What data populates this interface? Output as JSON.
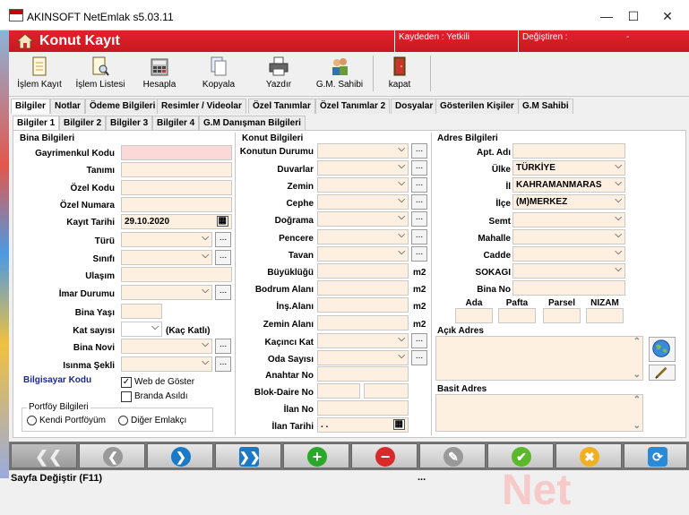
{
  "window": {
    "title": "AKINSOFT NetEmlak s5.03.11",
    "minimize": "—",
    "maximize": "☐",
    "close": "✕"
  },
  "header": {
    "form_title": "Konut Kayıt",
    "kaydeden": "Kaydeden : Yetkili",
    "degistiren": "Değiştiren :",
    "degistiren_value": "-",
    "color": "#d81e26"
  },
  "toolbar": [
    {
      "label": "İşlem Kayıt",
      "icon": "document-icon"
    },
    {
      "label": "İşlem Listesi",
      "icon": "search-document-icon"
    },
    {
      "label": "Hesapla",
      "icon": "calculator-icon"
    },
    {
      "label": "Kopyala",
      "icon": "copy-icon"
    },
    {
      "label": "Yazdır",
      "icon": "printer-icon"
    },
    {
      "label": "G.M. Sahibi",
      "icon": "users-icon"
    },
    {
      "label": "kapat",
      "icon": "exit-icon"
    }
  ],
  "tabs_main": [
    "Bilgiler",
    "Notlar",
    "Ödeme Bilgileri",
    "Resimler / Videolar",
    "Özel Tanımlar",
    "Özel Tanımlar 2",
    "Dosyalar",
    "Gösterilen Kişiler",
    "G.M Sahibi"
  ],
  "tabs_sub": [
    "Bilgiler 1",
    "Bilgiler 2",
    "Bilgiler 3",
    "Bilgiler 4",
    "G.M Danışman Bilgileri"
  ],
  "bina": {
    "section": "Bina Bilgileri",
    "gayrimenkul_kodu": "Gayrimenkul Kodu",
    "tanimi": "Tanımı",
    "ozel_kodu": "Özel Kodu",
    "ozel_numara": "Özel Numara",
    "kayit_tarihi": "Kayıt Tarihi",
    "kayit_tarihi_value": "29.10.2020",
    "turu": "Türü",
    "sinifi": "Sınıfı",
    "ulasim": "Ulaşım",
    "imar_durumu": "İmar Durumu",
    "bina_yasi": "Bina Yaşı",
    "kat_sayisi": "Kat sayısı",
    "kac_katli": "(Kaç Katlı)",
    "bina_novi": "Bina Novi",
    "isinma_sekli": "Isınma Şekli",
    "bilgisayar_kodu": "Bilgisayar Kodu",
    "web_de_goster": "Web de Göster",
    "branda_asildi": "Branda Asıldı",
    "portfoy": "Portföy Bilgileri",
    "kendi_portfoyum": "Kendi Portföyüm",
    "diger_emlakci": "Diğer Emlakçı",
    "dots": "..."
  },
  "konut": {
    "section": "Konut Bilgileri",
    "konutun_durumu": "Konutun Durumu",
    "duvarlar": "Duvarlar",
    "zemin": "Zemin",
    "cephe": "Cephe",
    "dograma": "Doğrama",
    "pencere": "Pencere",
    "tavan": "Tavan",
    "buyuklugu": "Büyüklüğü",
    "bodrum_alani": "Bodrum Alanı",
    "ins_alani": "İnş.Alanı",
    "zemin_alani": "Zemin Alanı",
    "kacinci_kat": "Kaçıncı Kat",
    "oda_sayisi": "Oda Sayısı",
    "anahtar_no": "Anahtar No",
    "blok_daire_no": "Blok-Daire No",
    "ilan_no": "İlan No",
    "ilan_tarihi": "İlan Tarihi",
    "ilan_tarihi_value": " .  .",
    "m2": "m2"
  },
  "adres": {
    "section": "Adres Bilgileri",
    "apt_adi": "Apt. Adı",
    "ulke": "Ülke",
    "ulke_value": "TÜRKİYE",
    "il": "İl",
    "il_value": "KAHRAMANMARAS",
    "ilce": "İlçe",
    "ilce_value": "(M)MERKEZ",
    "semt": "Semt",
    "mahalle": "Mahalle",
    "cadde": "Cadde",
    "sokagi": "SOKAGI",
    "bina_no": "Bina No",
    "ada": "Ada",
    "pafta": "Pafta",
    "parsel": "Parsel",
    "nizam": "NIZAM",
    "acik_adres": "Açık Adres",
    "basit_adres": "Basit Adres"
  },
  "nav": [
    {
      "icon": "first-record-icon",
      "glyph": "❮❮"
    },
    {
      "icon": "previous-record-icon",
      "glyph": "❮"
    },
    {
      "icon": "next-record-icon",
      "glyph": "❯"
    },
    {
      "icon": "last-record-icon",
      "glyph": "❯❯"
    },
    {
      "icon": "add-record-icon",
      "glyph": "+"
    },
    {
      "icon": "delete-record-icon",
      "glyph": "−"
    },
    {
      "icon": "edit-record-icon",
      "glyph": "✎"
    },
    {
      "icon": "save-record-icon",
      "glyph": "✔"
    },
    {
      "icon": "cancel-record-icon",
      "glyph": "✖"
    },
    {
      "icon": "refresh-icon",
      "glyph": "⟳"
    }
  ],
  "status": {
    "text": "Sayfa Değiştir (F11)",
    "dots": "..."
  },
  "watermark": "Net"
}
